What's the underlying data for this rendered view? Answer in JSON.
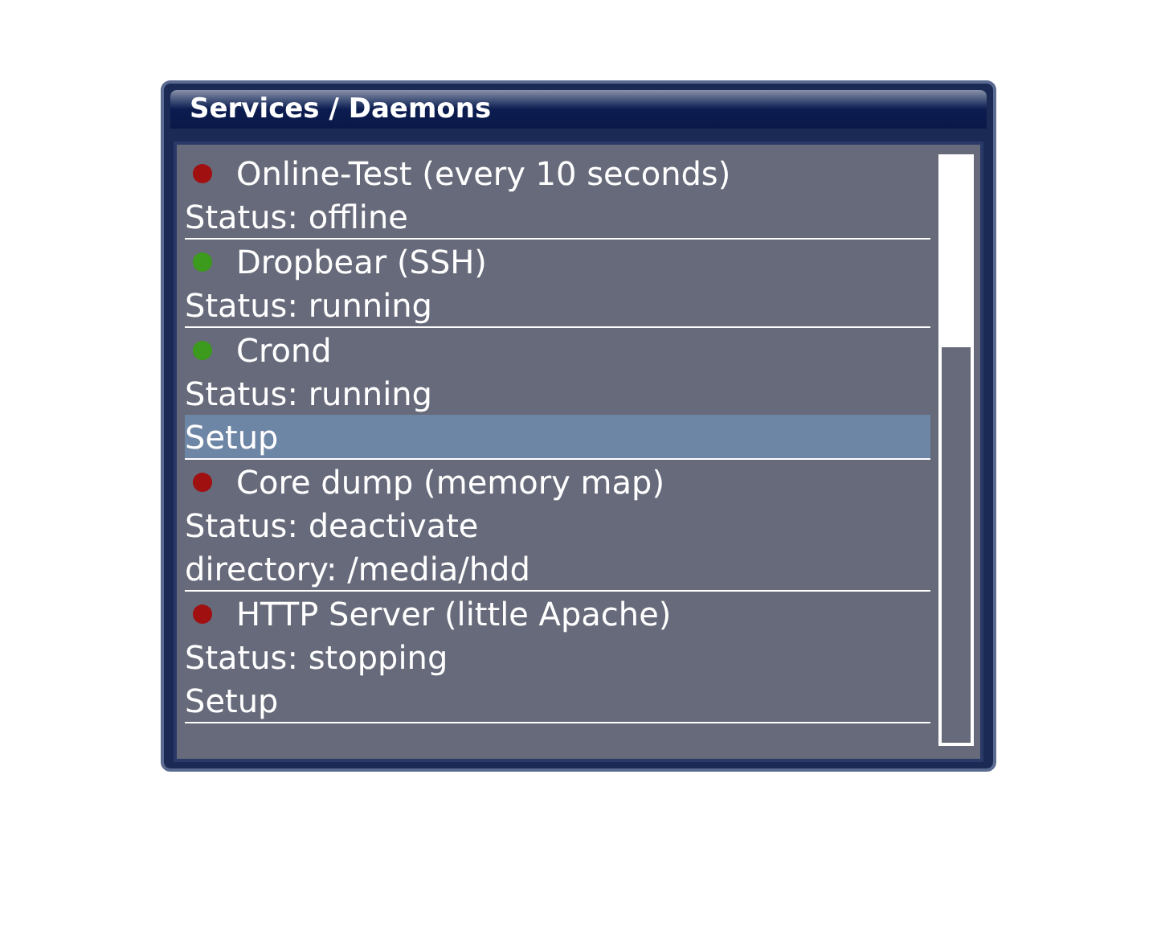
{
  "window": {
    "title": "Services / Daemons"
  },
  "services": [
    {
      "name": "Online-Test (every 10 seconds)",
      "color": "#a01010",
      "lines": [
        {
          "text": "Status: offline",
          "selected": false
        }
      ]
    },
    {
      "name": "Dropbear (SSH)",
      "color": "#3c9a1c",
      "lines": [
        {
          "text": "Status: running",
          "selected": false
        }
      ]
    },
    {
      "name": "Crond",
      "color": "#3c9a1c",
      "lines": [
        {
          "text": "Status: running",
          "selected": false
        },
        {
          "text": "Setup",
          "selected": true
        }
      ]
    },
    {
      "name": "Core dump (memory map)",
      "color": "#a01010",
      "lines": [
        {
          "text": "Status: deactivate",
          "selected": false
        },
        {
          "text": "directory: /media/hdd",
          "selected": false
        }
      ]
    },
    {
      "name": "HTTP Server (little Apache)",
      "color": "#a01010",
      "lines": [
        {
          "text": "Status: stopping",
          "selected": false
        },
        {
          "text": "Setup",
          "selected": false
        }
      ]
    }
  ]
}
